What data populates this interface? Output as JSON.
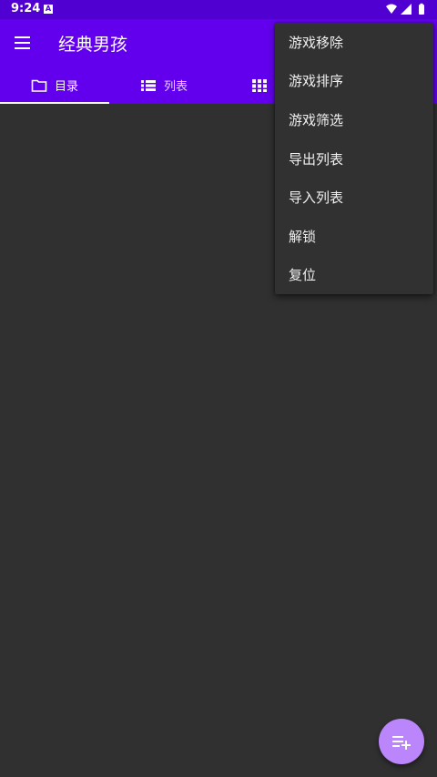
{
  "status_bar": {
    "time": "9:24",
    "notification_icon": "a-notification-icon",
    "icons": [
      "wifi-icon",
      "signal-icon",
      "battery-icon"
    ]
  },
  "app_bar": {
    "title": "经典男孩",
    "nav_icon": "menu-icon"
  },
  "tabs": [
    {
      "label": "目录",
      "icon": "folder-icon",
      "selected": true
    },
    {
      "label": "列表",
      "icon": "list-icon",
      "selected": false
    },
    {
      "label": "",
      "icon": "grid-icon",
      "selected": false
    }
  ],
  "overflow_menu": {
    "items": [
      {
        "label": "游戏移除"
      },
      {
        "label": "游戏排序"
      },
      {
        "label": "游戏筛选"
      },
      {
        "label": "导出列表"
      },
      {
        "label": "导入列表"
      },
      {
        "label": "解锁"
      },
      {
        "label": "复位"
      }
    ]
  },
  "fab": {
    "icon": "playlist-add-icon"
  },
  "colors": {
    "primary": "#6200ee",
    "status_bar": "#5000d0",
    "background": "#303030",
    "menu_background": "#313131",
    "fab": "#bb86fc"
  }
}
